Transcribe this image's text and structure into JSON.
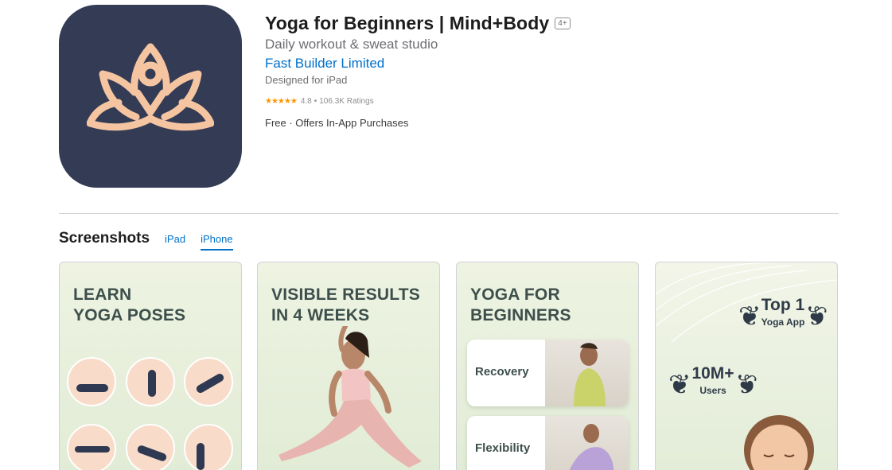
{
  "app": {
    "title": "Yoga for Beginners | Mind+Body",
    "age_rating": "4+",
    "subtitle": "Daily workout & sweat studio",
    "developer": "Fast Builder Limited",
    "designed_for": "Designed for iPad",
    "stars": "★★★★★",
    "rating": "4.8",
    "rating_separator": "•",
    "ratings_count": "106.3K Ratings",
    "price": "Free · Offers In-App Purchases",
    "icon": "lotus-icon"
  },
  "screenshots": {
    "title": "Screenshots",
    "tabs": [
      {
        "label": "iPad",
        "active": false
      },
      {
        "label": "iPhone",
        "active": true
      }
    ],
    "items": [
      {
        "headline_line1": "LEARN",
        "headline_line2": "YOGA POSES"
      },
      {
        "headline_line1": "VISIBLE RESULTS",
        "headline_line2": "IN 4 WEEKS"
      },
      {
        "headline_line1": "YOGA FOR",
        "headline_line2": "BEGINNERS",
        "cards": [
          "Recovery",
          "Flexibility"
        ]
      },
      {
        "badge1_title": "Top 1",
        "badge1_sub": "Yoga App",
        "badge2_title": "10M+",
        "badge2_sub": "Users"
      }
    ]
  },
  "colors": {
    "link": "#0070c9",
    "icon_bg": "#333b55",
    "icon_lotus": "#f5c4a1",
    "star": "#ff9500"
  }
}
